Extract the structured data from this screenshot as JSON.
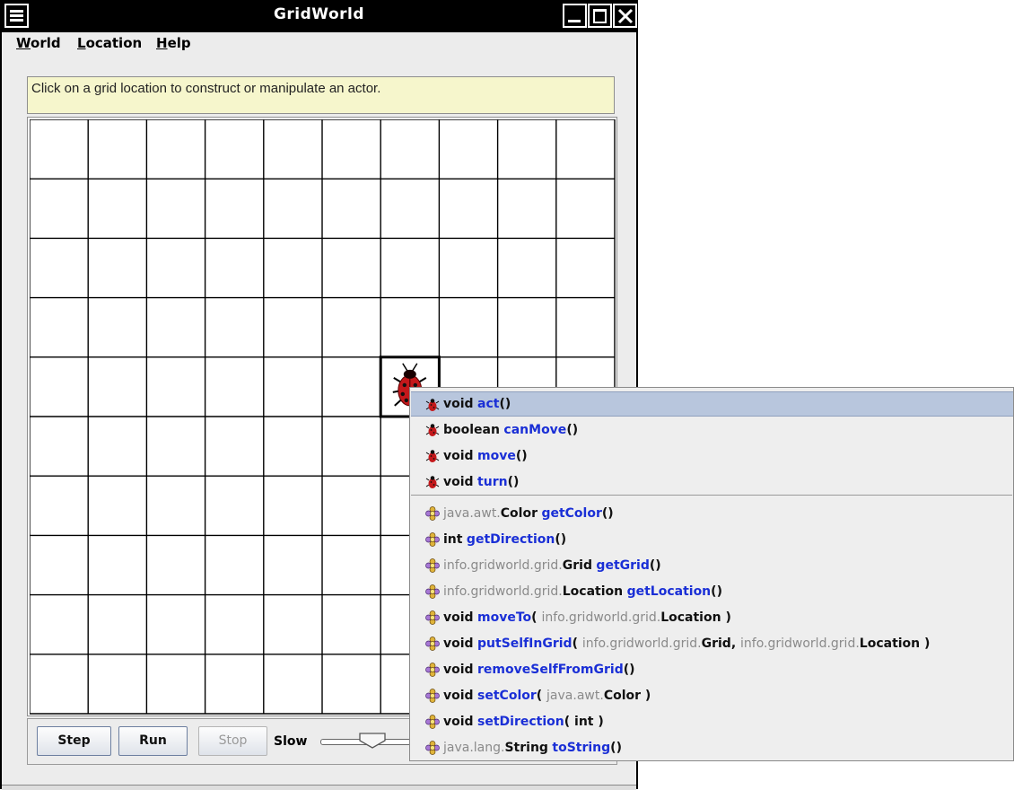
{
  "window": {
    "title": "GridWorld"
  },
  "menubar": [
    {
      "mnemonic": "W",
      "rest": "orld"
    },
    {
      "mnemonic": "L",
      "rest": "ocation"
    },
    {
      "mnemonic": "H",
      "rest": "elp"
    }
  ],
  "message": "Click on a grid location to construct or manipulate an actor.",
  "grid": {
    "rows": 10,
    "cols": 10,
    "bug": {
      "row": 4,
      "col": 6
    }
  },
  "controls": {
    "step_label": "Step",
    "run_label": "Run",
    "stop_label": "Stop",
    "speed_label": "Slow"
  },
  "popup": {
    "bug_methods": [
      {
        "ret": "void",
        "pkg": "",
        "name": "act",
        "open": "(",
        "params": [],
        "close": ")"
      },
      {
        "ret": "boolean",
        "pkg": "",
        "name": "canMove",
        "open": "(",
        "params": [],
        "close": ")"
      },
      {
        "ret": "void",
        "pkg": "",
        "name": "move",
        "open": "(",
        "params": [],
        "close": ")"
      },
      {
        "ret": "void",
        "pkg": "",
        "name": "turn",
        "open": "(",
        "params": [],
        "close": ")"
      }
    ],
    "actor_methods": [
      {
        "ret": "Color",
        "pkg": "java.awt.",
        "name": "getColor",
        "open": "(",
        "params": [],
        "close": ")"
      },
      {
        "ret": "int",
        "pkg": "",
        "name": "getDirection",
        "open": "(",
        "params": [],
        "close": ")"
      },
      {
        "ret": "Grid",
        "pkg": "info.gridworld.grid.",
        "name": "getGrid",
        "open": "(",
        "params": [],
        "close": ")"
      },
      {
        "ret": "Location",
        "pkg": "info.gridworld.grid.",
        "name": "getLocation",
        "open": "(",
        "params": [],
        "close": ")"
      },
      {
        "ret": "void",
        "pkg": "",
        "name": "moveTo",
        "open": "( ",
        "params": [
          {
            "pkg": "info.gridworld.grid.",
            "type": "Location"
          }
        ],
        "close": " )"
      },
      {
        "ret": "void",
        "pkg": "",
        "name": "putSelfInGrid",
        "open": "( ",
        "params": [
          {
            "pkg": "info.gridworld.grid.",
            "type": "Grid"
          },
          {
            "pkg": "info.gridworld.grid.",
            "type": "Location"
          }
        ],
        "close": " )"
      },
      {
        "ret": "void",
        "pkg": "",
        "name": "removeSelfFromGrid",
        "open": "(",
        "params": [],
        "close": ")"
      },
      {
        "ret": "void",
        "pkg": "",
        "name": "setColor",
        "open": "( ",
        "params": [
          {
            "pkg": "java.awt.",
            "type": "Color"
          }
        ],
        "close": " )"
      },
      {
        "ret": "void",
        "pkg": "",
        "name": "setDirection",
        "open": "( ",
        "params": [
          {
            "pkg": "",
            "type": "int"
          }
        ],
        "close": " )"
      },
      {
        "ret": "String",
        "pkg": "java.lang.",
        "name": "toString",
        "open": "(",
        "params": [],
        "close": ")"
      }
    ],
    "highlighted_index": 0
  },
  "colors": {
    "message_bg": "#f6f6cc",
    "method_name": "#1a2fd6",
    "highlight": "#b8c6dd",
    "bug_red": "#c4181b"
  },
  "icons": {
    "bug": "ladybug-icon",
    "actor": "flower-actor-icon"
  }
}
